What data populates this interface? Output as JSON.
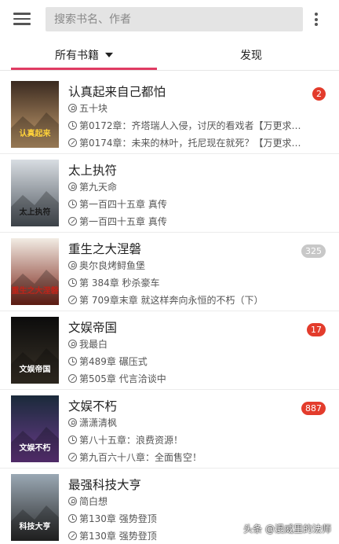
{
  "header": {
    "search_placeholder": "搜索书名、作者"
  },
  "tabs": {
    "all_books": "所有书籍",
    "discover": "发现"
  },
  "books": [
    {
      "title": "认真起来自己都怕",
      "author": "五十块",
      "latest": "第0172章：齐塔瑞人入侵，讨厌的看戏者【万更求订...",
      "current": "第0174章：未来的林叶，托尼现在就死？【万更求订...",
      "badge": "2",
      "badge_style": "red",
      "cover_text": "认真起来"
    },
    {
      "title": "太上执符",
      "author": "第九天命",
      "latest": "第一百四十五章  真传",
      "current": "第一百四十五章  真传",
      "badge": "",
      "badge_style": "none",
      "cover_text": "太上执符"
    },
    {
      "title": "重生之大涅磐",
      "author": "奥尔良烤鲟鱼堡",
      "latest": "第 384章 秒杀豪车",
      "current": "第 709章末章 就这样奔向永恒的不朽（下）",
      "badge": "325",
      "badge_style": "grey",
      "cover_text": "重生之大涅磐"
    },
    {
      "title": "文娱帝国",
      "author": "我最白",
      "latest": "第489章 碾压式",
      "current": "第505章 代言洽谈中",
      "badge": "17",
      "badge_style": "red",
      "cover_text": "文娱帝国"
    },
    {
      "title": "文娱不朽",
      "author": "潇潇清枫",
      "latest": "第八十五章：浪费资源！",
      "current": "第九百六十八章：全面售空！",
      "badge": "887",
      "badge_style": "red",
      "cover_text": "文娱不朽"
    },
    {
      "title": "最强科技大亨",
      "author": "简白想",
      "latest": "第130章  强势登顶",
      "current": "第130章  强势登顶",
      "badge": "",
      "badge_style": "none",
      "cover_text": "科技大亨"
    }
  ],
  "watermark": "头条 @漫威里的法师",
  "colors": {
    "accent": "#e03b63",
    "badge_red": "#e33c2c",
    "badge_grey": "#c8c8c8"
  }
}
